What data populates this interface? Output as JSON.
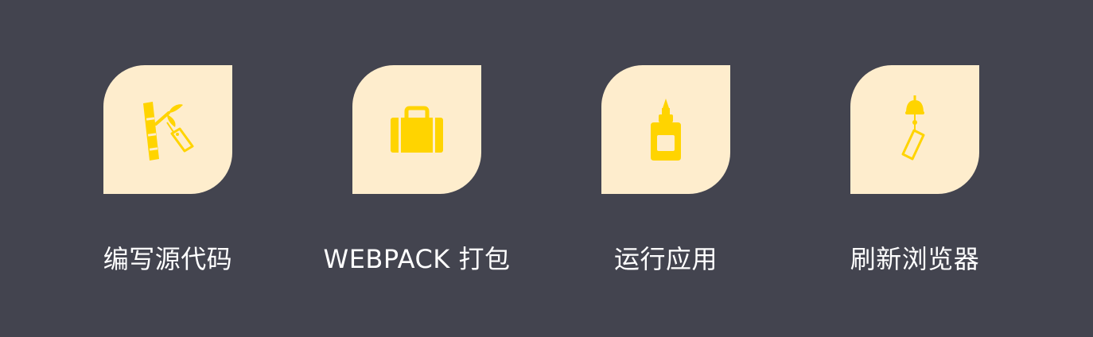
{
  "colors": {
    "background": "#43444f",
    "tile": "#feedcd",
    "icon": "#ffd400",
    "label": "#ffffff"
  },
  "steps": [
    {
      "icon": "bamboo-tag-icon",
      "label": "编写源代码"
    },
    {
      "icon": "suitcase-icon",
      "label": "WEBPACK 打包"
    },
    {
      "icon": "glue-bottle-icon",
      "label": "运行应用"
    },
    {
      "icon": "wind-chime-icon",
      "label": "刷新浏览器"
    }
  ]
}
